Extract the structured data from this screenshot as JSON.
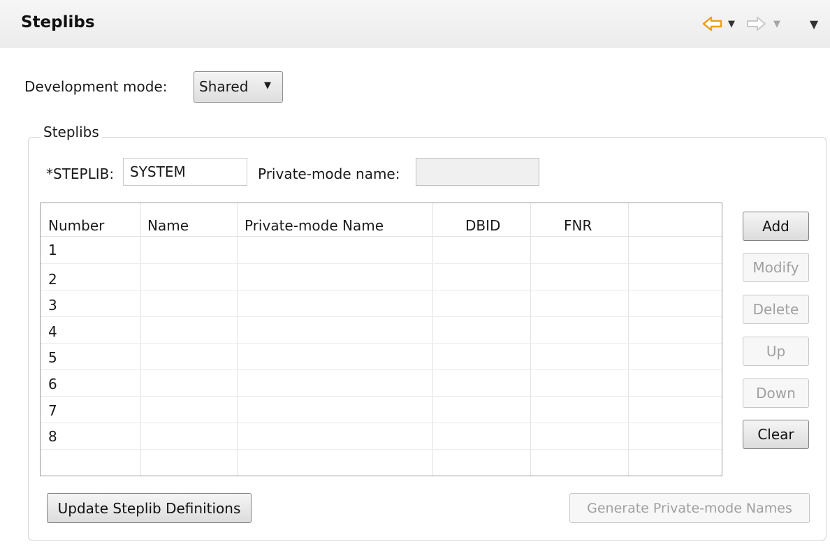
{
  "header": {
    "title": "Steplibs",
    "nav_back_icon": "arrow-left-icon",
    "nav_forward_icon": "arrow-right-icon",
    "back_color": "#e8a21a",
    "forward_color": "#c8c8c8"
  },
  "dev_mode": {
    "label": "Development mode:",
    "selected": "Shared"
  },
  "group": {
    "title": "Steplibs",
    "steplib_label": "*STEPLIB:",
    "steplib_value": "SYSTEM",
    "private_label": "Private-mode name:",
    "private_value": ""
  },
  "table": {
    "columns": [
      "Number",
      "Name",
      "Private-mode Name",
      "DBID",
      "FNR",
      ""
    ],
    "rows": [
      [
        "1",
        "",
        "",
        "",
        "",
        ""
      ],
      [
        "2",
        "",
        "",
        "",
        "",
        ""
      ],
      [
        "3",
        "",
        "",
        "",
        "",
        ""
      ],
      [
        "4",
        "",
        "",
        "",
        "",
        ""
      ],
      [
        "5",
        "",
        "",
        "",
        "",
        ""
      ],
      [
        "6",
        "",
        "",
        "",
        "",
        ""
      ],
      [
        "7",
        "",
        "",
        "",
        "",
        ""
      ],
      [
        "8",
        "",
        "",
        "",
        "",
        ""
      ]
    ]
  },
  "buttons": {
    "add": "Add",
    "modify": "Modify",
    "delete": "Delete",
    "up": "Up",
    "down": "Down",
    "clear": "Clear",
    "update": "Update Steplib Definitions",
    "generate": "Generate Private-mode Names"
  }
}
